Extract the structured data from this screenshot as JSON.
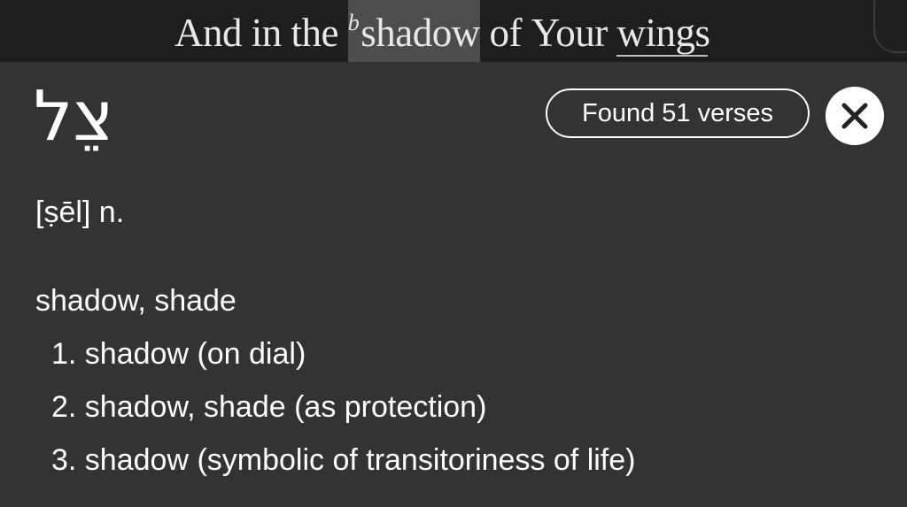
{
  "verse": {
    "words": [
      {
        "text": "And",
        "highlight": false,
        "underline": false
      },
      {
        "text": "in",
        "highlight": false,
        "underline": false
      },
      {
        "text": "the",
        "highlight": false,
        "underline": false
      },
      {
        "text": "shadow",
        "footnote": "b",
        "highlight": true,
        "underline": false
      },
      {
        "text": "of",
        "highlight": false,
        "underline": false
      },
      {
        "text": "Your",
        "highlight": false,
        "underline": false
      },
      {
        "text": "wings",
        "highlight": false,
        "underline": true
      }
    ]
  },
  "lexicon": {
    "lemma": "צֵל",
    "pronunciation": "[ṣēl] n.",
    "gloss": "shadow, shade",
    "senses": [
      "1. shadow (on dial)",
      "2. shadow, shade (as protection)",
      "3. shadow (symbolic of transitoriness of life)"
    ]
  },
  "actions": {
    "found_label": "Found 51 verses",
    "close_icon": "close-icon"
  },
  "colors": {
    "background": "#333333",
    "verse_bar": "#1e1e1e",
    "highlight": "#4d4d4d",
    "text": "#ffffff"
  }
}
